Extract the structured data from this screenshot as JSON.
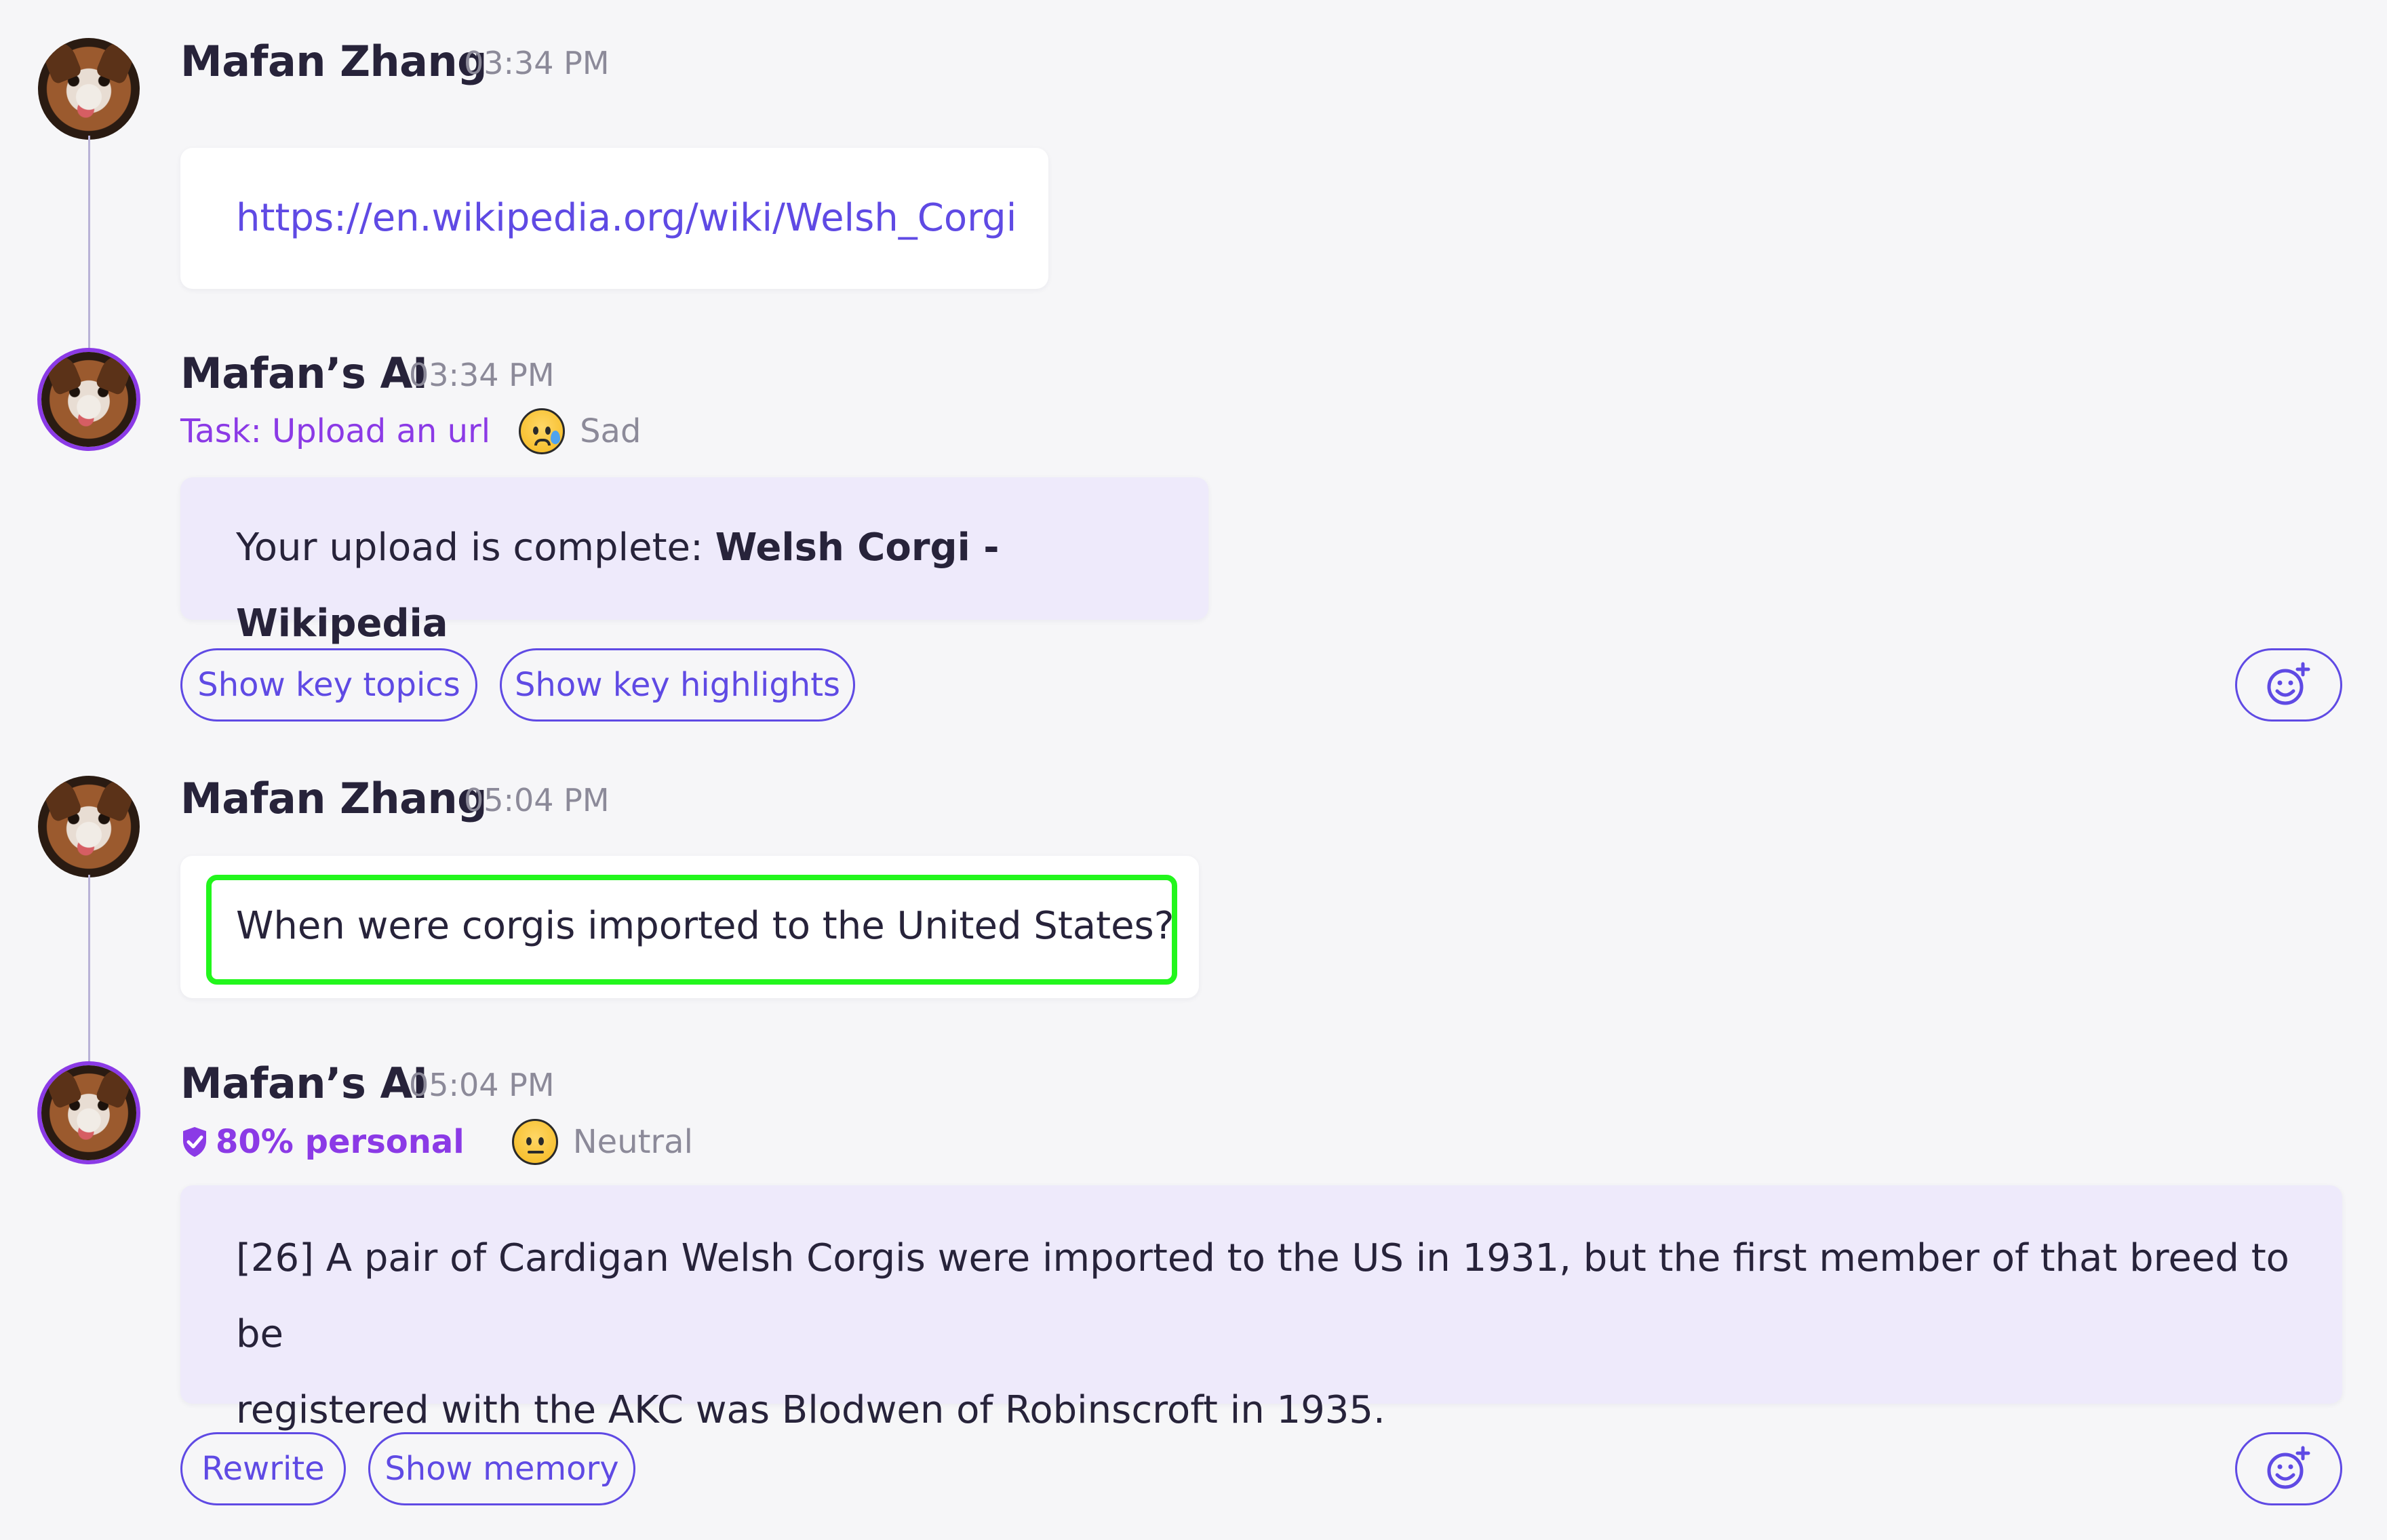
{
  "messages": [
    {
      "sender": "Mafan Zhang",
      "time": "03:34 PM",
      "link": "https://en.wikipedia.org/wiki/Welsh_Corgi"
    },
    {
      "sender": "Mafan’s AI",
      "time": "03:34 PM",
      "task": "Task: Upload an url",
      "mood": {
        "icon": "sad-tear-emoji-icon",
        "label": "Sad"
      },
      "text_prefix": "Your upload is complete: ",
      "text_bold": "Welsh Corgi - Wikipedia",
      "actions": [
        "Show key topics",
        "Show key highlights"
      ]
    },
    {
      "sender": "Mafan Zhang",
      "time": "05:04 PM",
      "text": "When were corgis imported to the United States?"
    },
    {
      "sender": "Mafan’s AI",
      "time": "05:04 PM",
      "personal": "80% personal",
      "mood": {
        "icon": "neutral-face-emoji-icon",
        "label": "Neutral"
      },
      "text_line1": "[26] A pair of Cardigan Welsh Corgis were imported to the US in 1931, but the first member of that breed to be",
      "text_line2": "registered with the AKC was Blodwen of Robinscroft in 1935.",
      "actions": [
        "Rewrite",
        "Show memory"
      ]
    }
  ],
  "colors": {
    "background": "#f6f6f8",
    "accent": "#5f4ae4",
    "ai_purple": "#8b3ae6",
    "ai_bubble": "#eeeafb",
    "highlight": "#22f61c"
  }
}
